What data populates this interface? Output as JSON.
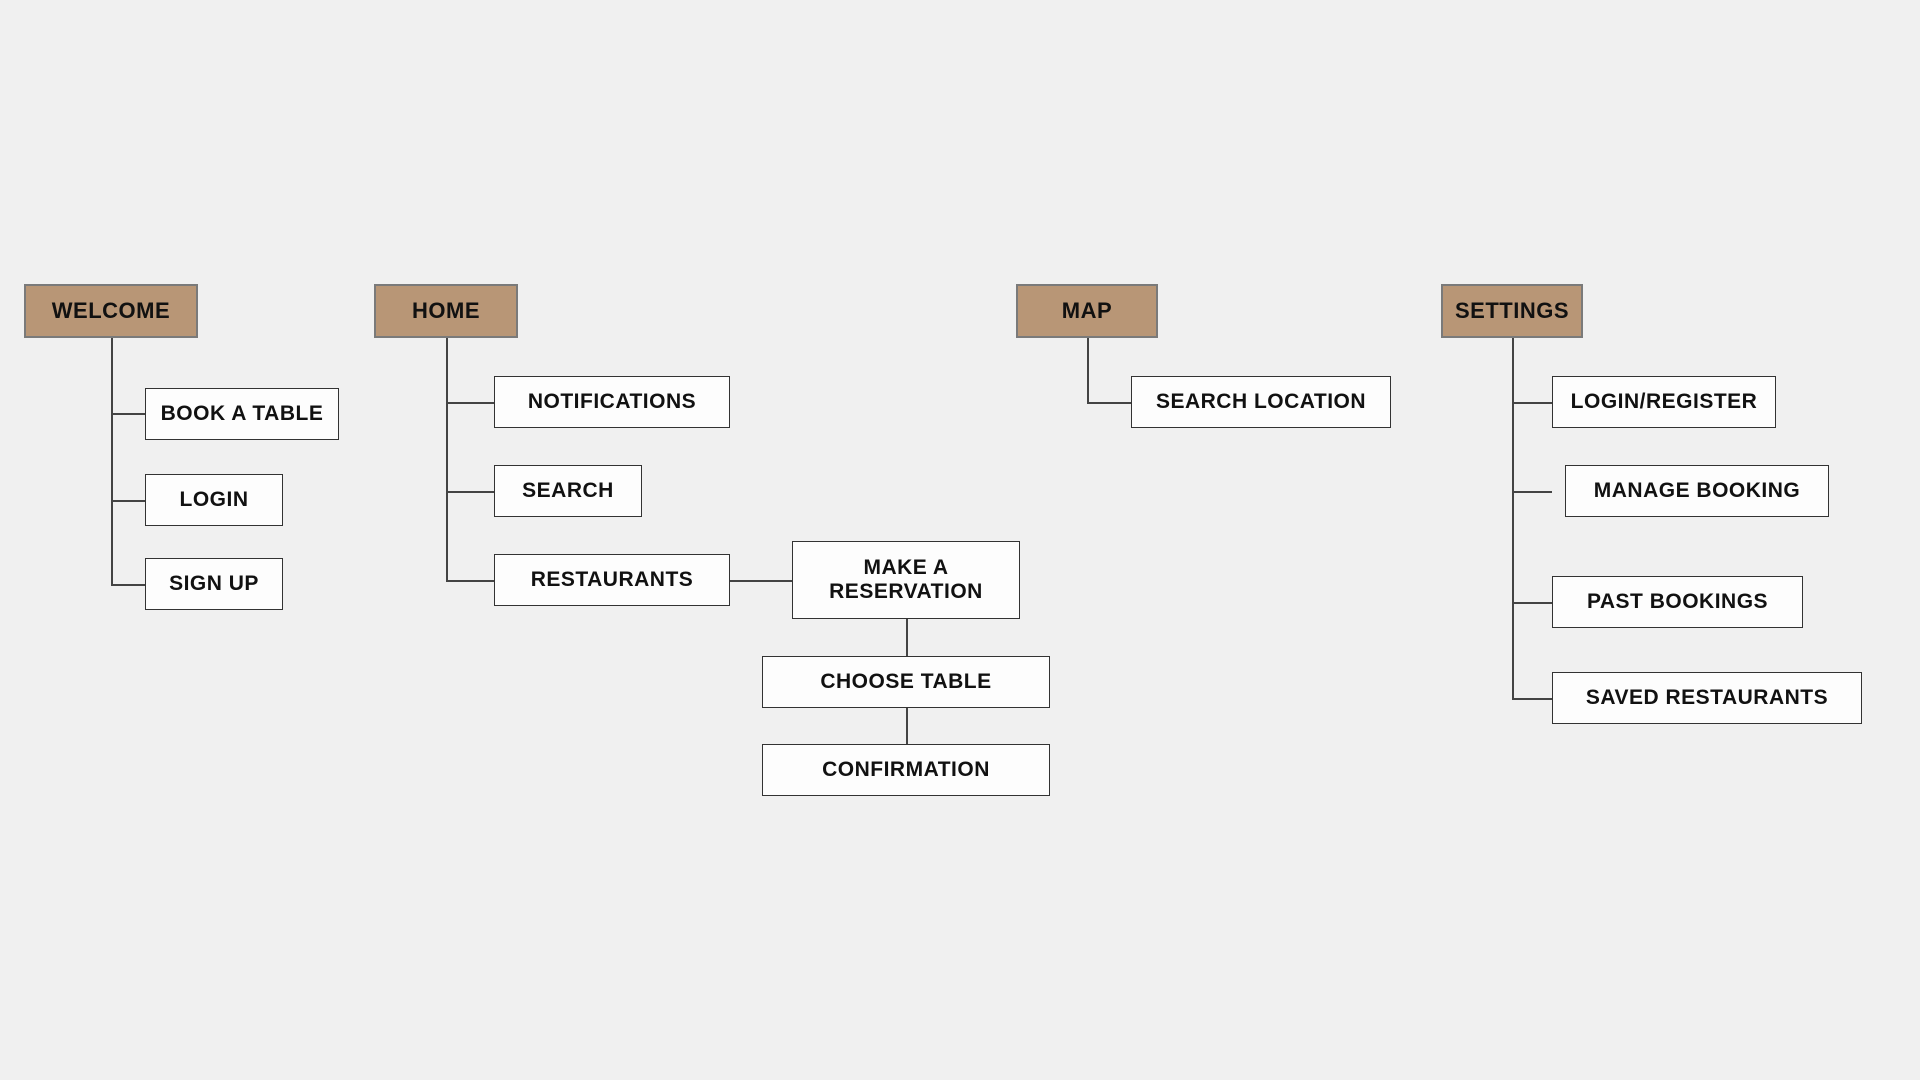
{
  "colors": {
    "parent_bg": "#b89676",
    "child_bg": "#fdfdfd",
    "page_bg": "#f0f0f0"
  },
  "sitemap": {
    "welcome": {
      "label": "WELCOME",
      "children": {
        "book_a_table": "BOOK A TABLE",
        "login": "LOGIN",
        "sign_up": "SIGN UP"
      }
    },
    "home": {
      "label": "HOME",
      "children": {
        "notifications": "NOTIFICATIONS",
        "search": "SEARCH",
        "restaurants": {
          "label": "RESTAURANTS",
          "children": {
            "make_reservation": "MAKE A RESERVATION",
            "choose_table": "CHOOSE TABLE",
            "confirmation": "CONFIRMATION"
          }
        }
      }
    },
    "map": {
      "label": "MAP",
      "children": {
        "search_location": "SEARCH LOCATION"
      }
    },
    "settings": {
      "label": "SETTINGS",
      "children": {
        "login_register": "LOGIN/REGISTER",
        "manage_booking": "MANAGE BOOKING",
        "past_bookings": "PAST BOOKINGS",
        "saved_restaurants": "SAVED RESTAURANTS"
      }
    }
  }
}
